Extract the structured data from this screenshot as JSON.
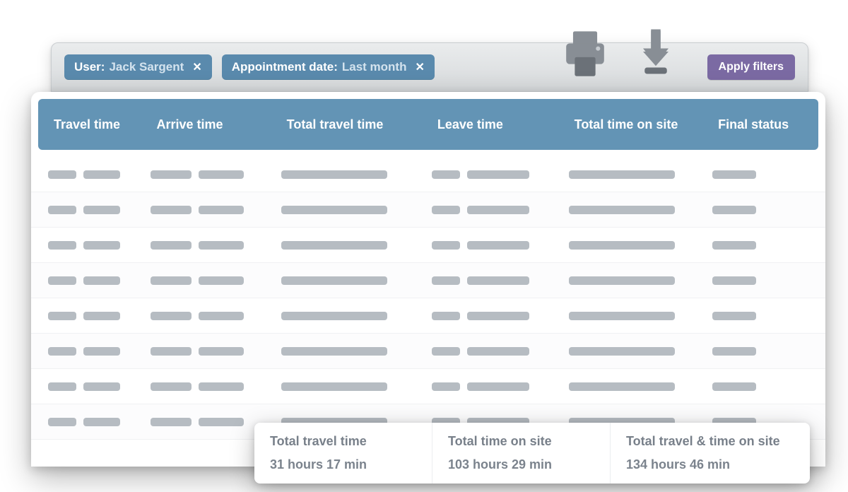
{
  "toolbar": {
    "filters": [
      {
        "label": "User:",
        "value": "Jack Sargent"
      },
      {
        "label": "Appointment date:",
        "value": "Last month"
      }
    ],
    "apply_label": "Apply filters"
  },
  "table": {
    "columns": [
      "Travel time",
      "Arrive time",
      "Total travel time",
      "Leave time",
      "Total time on site",
      "Final status"
    ],
    "row_count": 8
  },
  "summary": {
    "cells": [
      {
        "label": "Total travel time",
        "value": "31 hours 17 min"
      },
      {
        "label": "Total time on site",
        "value": "103 hours 29 min"
      },
      {
        "label": "Total travel & time on site",
        "value": "134 hours 46 min"
      }
    ]
  },
  "colors": {
    "header_blue": "#6394b5",
    "chip_blue": "#5a8aad",
    "apply_purple": "#7b6aa3",
    "placeholder_gray": "#b6bcc2"
  }
}
